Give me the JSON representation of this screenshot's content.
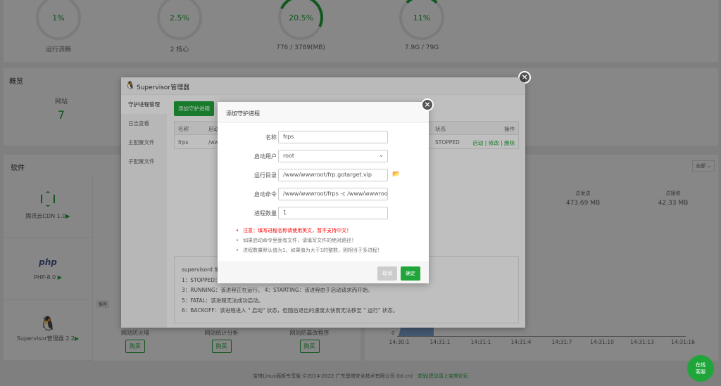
{
  "gauges": [
    {
      "value": "1%",
      "label": "运行流畅",
      "fraction": 0.01
    },
    {
      "value": "2.5%",
      "label": "2 核心",
      "fraction": 0.025
    },
    {
      "value": "20.5%",
      "label": "776 / 3789(MB)",
      "fraction": 0.205
    },
    {
      "value": "11%",
      "label": "7.9G / 79G",
      "fraction": 0.11
    }
  ],
  "overview": {
    "title": "概览",
    "site_label": "网站",
    "site_count": "7"
  },
  "software": {
    "title": "软件",
    "items": [
      {
        "name": "腾讯云CDN 1.0",
        "icon": "tencent-cdn-icon"
      },
      {
        "name": "PHP-8.0",
        "icon": "php-icon"
      },
      {
        "name": "Supervisor管理器 2.2",
        "icon": "penguin-icon"
      }
    ],
    "recommend_badge": "推荐",
    "recommended": [
      {
        "name": "网站防火墙",
        "buy": "购买"
      },
      {
        "name": "网站统计分析",
        "buy": "购买"
      },
      {
        "name": "网站防篡改程序",
        "buy": "购买"
      }
    ]
  },
  "traffic": {
    "filter": "全部",
    "sent_label": "总发送",
    "sent_value": "473.69 MB",
    "recv_label": "总接收",
    "recv_value": "42.33 MB",
    "y_zero": "0",
    "x_ticks": [
      "14:30:1",
      "14:31:1",
      "14:31:1",
      "14:31:4",
      "14:31:7",
      "14:31:10",
      "14:31:13",
      "14:31:16"
    ]
  },
  "footer": {
    "copyright": "宝塔Linux面板专享版 ©2014-2022 广东堡塔安全技术有限公司 (bt.cn)",
    "forum_link": "求助|建议请上宝塔论坛"
  },
  "chat_button": "在线客服",
  "supervisor": {
    "title": "Supervisor管理器",
    "menu": [
      "守护进程管理",
      "日志查看",
      "主配置文件",
      "子配置文件"
    ],
    "add_button": "添加守护进程",
    "table": {
      "headers": [
        "名称",
        "启动",
        "状态",
        "操作"
      ],
      "rows": [
        {
          "name": "frps",
          "cmd": "/ww",
          "status": "STOPPED",
          "actions": [
            "启动",
            "修改",
            "删除"
          ]
        }
      ]
    },
    "notes": [
      "supervisord 常",
      "1：STOPPED：",
      "3：RUNNING：该进程正在运行。 4：STARTING：该进程由于启动请求而开始。",
      "5：FATAL：该进程无法成功启动。",
      "6：BACKOFF：该进程进入 \" 启动\" 状态，但随后退出的速度太快而无法移至 \" 运行\" 状态。"
    ]
  },
  "dialog": {
    "title": "添加守护进程",
    "fields": [
      {
        "label": "名称",
        "value": "frps"
      },
      {
        "label": "启动用户",
        "value": "root"
      },
      {
        "label": "运行目录",
        "value": "/www/wwwroot/frp.gotarget.vip"
      },
      {
        "label": "启动命令",
        "value": "/www/wwwroot/frps -c /www/wwwroot/frps."
      },
      {
        "label": "进程数量",
        "value": "1"
      }
    ],
    "tips": [
      "注意：填写进程名称请使用英文，暂不支持中文！",
      "如果启动命令里面有文件，请填写文件的绝对路径！",
      "进程数量默认值为1，如果值为大于1的整数，则相当于多进程！"
    ],
    "cancel": "取消",
    "confirm": "确定"
  },
  "colors": {
    "accent": "#20a53a",
    "danger": "#ff0000"
  }
}
